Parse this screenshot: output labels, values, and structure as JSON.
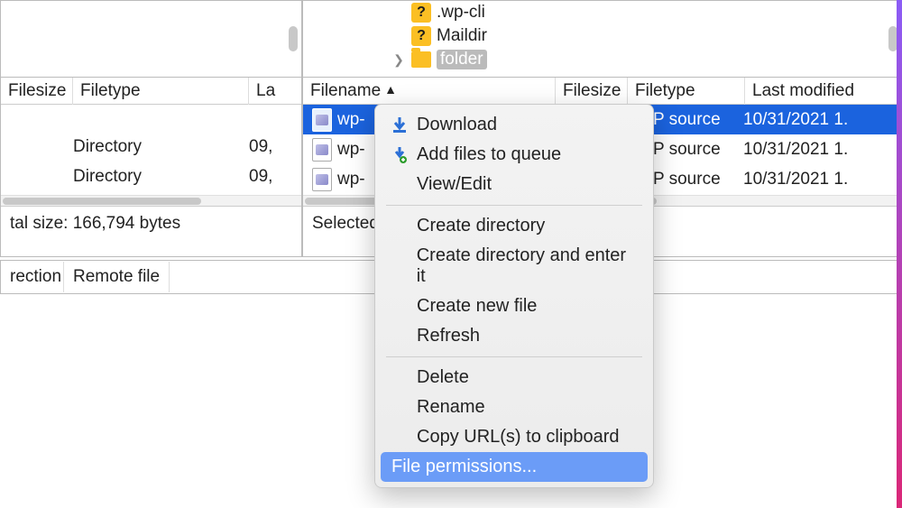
{
  "leftPane": {
    "headers": {
      "filesize": "Filesize",
      "filetype": "Filetype",
      "lastmod": "La"
    },
    "rows": [
      {
        "filetype": "Directory",
        "lastmod": "09,"
      },
      {
        "filetype": "Directory",
        "lastmod": "09,"
      }
    ],
    "status": "tal size: 166,794 bytes"
  },
  "rightPane": {
    "treeItems": [
      {
        "name": ".wp-cli"
      },
      {
        "name": "Maildir"
      },
      {
        "name": "folder",
        "expandable": true,
        "selected": true
      }
    ],
    "headers": {
      "filename": "Filename",
      "filesize": "Filesize",
      "filetype": "Filetype",
      "lastmod": "Last modified"
    },
    "rows": [
      {
        "name": "wp-",
        "filetype": "P source",
        "lastmod": "10/31/2021 1.",
        "selected": true
      },
      {
        "name": "wp-",
        "filetype": "P source",
        "lastmod": "10/31/2021 1."
      },
      {
        "name": "wp-",
        "filetype": "P source",
        "lastmod": "10/31/2021 1."
      }
    ],
    "status": "Selected"
  },
  "infobar": {
    "direction": "rection",
    "remotefile": "Remote file"
  },
  "contextMenu": {
    "items": [
      {
        "label": "Download",
        "icon": "download"
      },
      {
        "label": "Add files to queue",
        "icon": "addqueue"
      },
      {
        "label": "View/Edit"
      },
      {
        "sep": true
      },
      {
        "label": "Create directory"
      },
      {
        "label": "Create directory and enter it"
      },
      {
        "label": "Create new file"
      },
      {
        "label": "Refresh"
      },
      {
        "sep": true
      },
      {
        "label": "Delete"
      },
      {
        "label": "Rename"
      },
      {
        "label": "Copy URL(s) to clipboard"
      },
      {
        "label": "File permissions...",
        "highlighted": true
      }
    ]
  }
}
